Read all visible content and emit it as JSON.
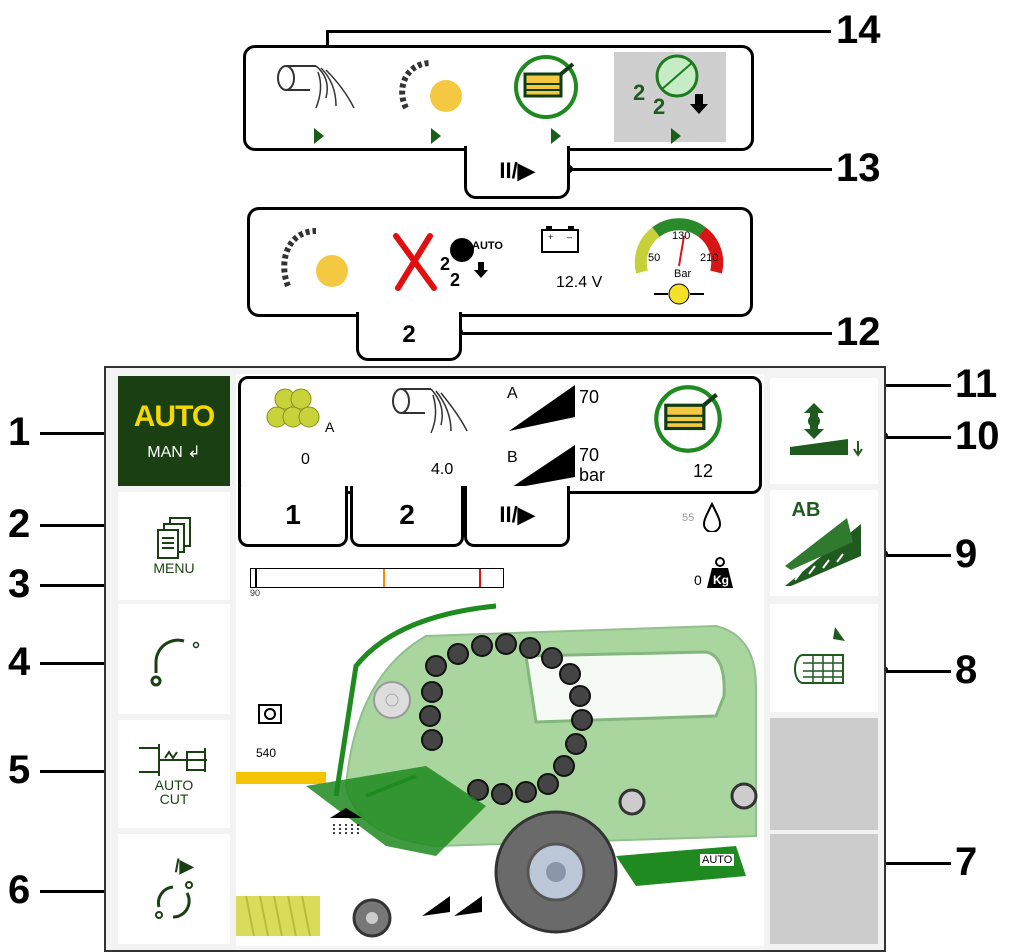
{
  "callouts": [
    "1",
    "2",
    "3",
    "4",
    "5",
    "6",
    "7",
    "8",
    "9",
    "10",
    "11",
    "12",
    "13",
    "14"
  ],
  "panel14": {
    "play_symbol": "II/▶"
  },
  "panel12": {
    "voltage": "12.4 V",
    "auto_label": "AUTO",
    "gauge_top": "130",
    "gauge_left": "50",
    "gauge_right": "210",
    "gauge_unit": "Bar",
    "tab_label": "2"
  },
  "left": {
    "auto_label": "AUTO",
    "man_label": "MAN",
    "menu_label": "MENU",
    "autocut_label": "AUTO\nCUT",
    "bar_scale": "90",
    "rotate_label": "/▶"
  },
  "info": {
    "bales_group": "A",
    "bales_count": "0",
    "net_value": "4.0",
    "knife_a_label": "A",
    "knife_a_value": "70",
    "knife_b_label": "B",
    "knife_b_value": "70",
    "knife_unit": "bar",
    "pickup_value": "12"
  },
  "tabs": [
    "1",
    "2",
    "II/▶"
  ],
  "status": {
    "moisture": "55",
    "weight": "0",
    "pto": "540",
    "auto_mode": "AUTO"
  },
  "right": {
    "ab_label": "AB"
  },
  "colors": {
    "brand_green": "#1f7a1f",
    "dark_green": "#0f3d12",
    "light_green": "#9bd08f",
    "panel_gray": "#cccccc"
  }
}
